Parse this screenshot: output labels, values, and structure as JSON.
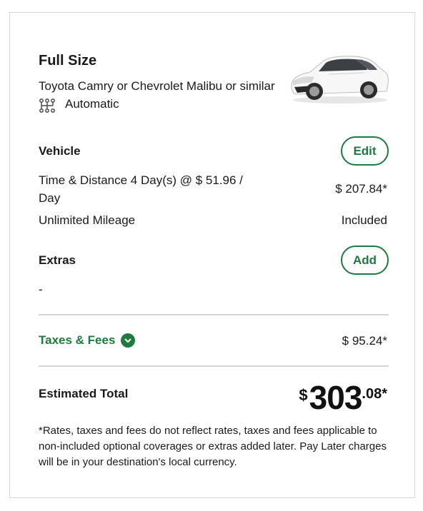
{
  "vehicle_class": {
    "title": "Full Size",
    "model": "Toyota Camry or Chevrolet Malibu or similar",
    "transmission": "Automatic"
  },
  "vehicle_section": {
    "heading": "Vehicle",
    "edit_label": "Edit",
    "line_items": [
      {
        "label": "Time & Distance 4 Day(s) @ $ 51.96 / Day",
        "amount": "$ 207.84*"
      },
      {
        "label": "Unlimited Mileage",
        "amount": "Included"
      }
    ]
  },
  "extras_section": {
    "heading": "Extras",
    "add_label": "Add",
    "value": "-"
  },
  "taxes": {
    "label": "Taxes & Fees",
    "amount": "$ 95.24*"
  },
  "total": {
    "label": "Estimated Total",
    "currency": "$",
    "whole": "303",
    "cents": ".08*"
  },
  "disclaimer": "*Rates, taxes and fees do not reflect rates, taxes and fees applicable to non-included optional coverages or extras added later. Pay Later charges will be in your destination's local currency.",
  "icons": {
    "transmission": "gear-shift-icon",
    "taxes_toggle": "chevron-down-icon"
  },
  "colors": {
    "accent": "#1f7a3f",
    "divider": "#d3d3d3",
    "border": "#d6d6d6"
  }
}
